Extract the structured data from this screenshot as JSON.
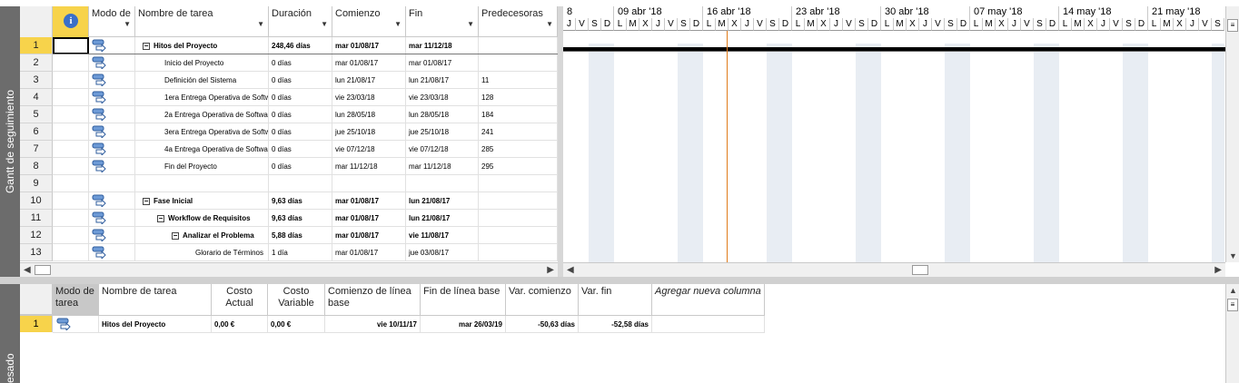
{
  "view_labels": {
    "top": "Gantt de seguimiento",
    "bottom": "esado"
  },
  "grid": {
    "headers": {
      "info": "i",
      "mode": "Modo de",
      "name": "Nombre de tarea",
      "duration": "Duración",
      "start": "Comienzo",
      "end": "Fin",
      "pred": "Predecesoras"
    },
    "rows": [
      {
        "id": "1",
        "name": "Hitos del Proyecto",
        "duration": "248,46 días",
        "start": "mar 01/08/17",
        "end": "mar 11/12/18",
        "pred": "",
        "bold": true,
        "level": 1,
        "collapse": true
      },
      {
        "id": "2",
        "name": "Inicio del Proyecto",
        "duration": "0 días",
        "start": "mar 01/08/17",
        "end": "mar 01/08/17",
        "pred": "",
        "bold": false,
        "level": 2
      },
      {
        "id": "3",
        "name": "Definición del Sistema",
        "duration": "0 días",
        "start": "lun 21/08/17",
        "end": "lun 21/08/17",
        "pred": "11",
        "bold": false,
        "level": 2
      },
      {
        "id": "4",
        "name": "1era Entrega Operativa de Softwa",
        "duration": "0 días",
        "start": "vie 23/03/18",
        "end": "vie 23/03/18",
        "pred": "128",
        "bold": false,
        "level": 2
      },
      {
        "id": "5",
        "name": "2a Entrega Operativa de Software",
        "duration": "0 días",
        "start": "lun 28/05/18",
        "end": "lun 28/05/18",
        "pred": "184",
        "bold": false,
        "level": 2
      },
      {
        "id": "6",
        "name": "3era Entrega Operativa de Softwa",
        "duration": "0 días",
        "start": "jue 25/10/18",
        "end": "jue 25/10/18",
        "pred": "241",
        "bold": false,
        "level": 2
      },
      {
        "id": "7",
        "name": "4a Entrega Operativa de Softwa",
        "duration": "0 días",
        "start": "vie 07/12/18",
        "end": "vie 07/12/18",
        "pred": "285",
        "bold": false,
        "level": 2
      },
      {
        "id": "8",
        "name": "Fin del Proyecto",
        "duration": "0 días",
        "start": "mar 11/12/18",
        "end": "mar 11/12/18",
        "pred": "295",
        "bold": false,
        "level": 2
      },
      {
        "id": "9",
        "name": "",
        "duration": "",
        "start": "",
        "end": "",
        "pred": "",
        "bold": false,
        "level": 0,
        "empty": true
      },
      {
        "id": "10",
        "name": "Fase Inicial",
        "duration": "9,63 días",
        "start": "mar 01/08/17",
        "end": "lun 21/08/17",
        "pred": "",
        "bold": true,
        "level": 1,
        "collapse": true
      },
      {
        "id": "11",
        "name": "Workflow de Requisitos",
        "duration": "9,63 días",
        "start": "mar 01/08/17",
        "end": "lun 21/08/17",
        "pred": "",
        "bold": true,
        "level": 2,
        "collapse": true
      },
      {
        "id": "12",
        "name": "Analizar el Problema",
        "duration": "5,88 días",
        "start": "mar 01/08/17",
        "end": "vie 11/08/17",
        "pred": "",
        "bold": true,
        "level": 3,
        "collapse": true
      },
      {
        "id": "13",
        "name": "Glorario de Términos",
        "duration": "1 día",
        "start": "mar 01/08/17",
        "end": "jue 03/08/17",
        "pred": "",
        "bold": false,
        "level": 4
      }
    ]
  },
  "gantt": {
    "weeks": [
      "8",
      "09 abr '18",
      "16 abr '18",
      "23 abr '18",
      "30 abr '18",
      "07 may '18",
      "14 may '18",
      "21 may '18"
    ],
    "day_letters": [
      "J",
      "V",
      "S",
      "D",
      "L",
      "M",
      "X",
      "J",
      "V",
      "S",
      "D",
      "L",
      "M",
      "X",
      "J",
      "V",
      "S",
      "D",
      "L",
      "M",
      "X",
      "J",
      "V",
      "S",
      "D",
      "L",
      "M",
      "X",
      "J",
      "V",
      "S",
      "D",
      "L",
      "M",
      "X",
      "J",
      "V",
      "S",
      "D",
      "L",
      "M",
      "X",
      "J",
      "V",
      "S",
      "D",
      "L",
      "M",
      "X",
      "J",
      "V",
      "S"
    ],
    "today_line_color": "#e07a1a"
  },
  "bottom_grid": {
    "headers": {
      "mode": "Modo de tarea",
      "name": "Nombre de tarea",
      "cost_actual": "Costo Actual",
      "cost_var": "Costo Variable",
      "base_start": "Comienzo de línea base",
      "base_end": "Fin de línea base",
      "var_start": "Var. comienzo",
      "var_end": "Var. fin",
      "add_col": "Agregar nueva columna"
    },
    "rows": [
      {
        "id": "1",
        "name": "Hitos del Proyecto",
        "cost_actual": "0,00 €",
        "cost_var": "0,00 €",
        "base_start": "vie 10/11/17",
        "base_end": "mar 26/03/19",
        "var_start": "-50,63 días",
        "var_end": "-52,58 días"
      }
    ]
  },
  "colors": {
    "selected_row": "#f7d34b",
    "weekend_shade": "#e8edf3",
    "viewbar": "#6c6c6c"
  }
}
